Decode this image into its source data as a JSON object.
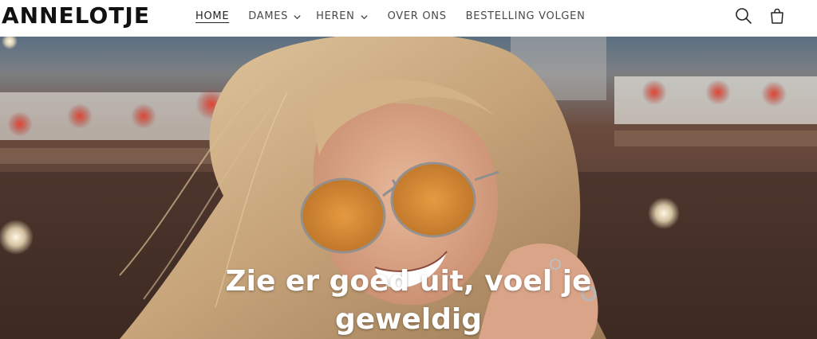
{
  "header": {
    "logo": "ANNELOTJE",
    "nav": [
      {
        "label": "HOME",
        "active": true
      },
      {
        "label": "DAMES",
        "dropdown": true
      },
      {
        "label": "HEREN",
        "dropdown": true
      },
      {
        "label": "OVER ONS"
      },
      {
        "label": "BESTELLING VOLGEN"
      }
    ],
    "icons": {
      "search": "search-icon",
      "cart": "shopping-bag-icon",
      "dropdown": "chevron-down-icon"
    }
  },
  "hero": {
    "heading_line1": "Zie er goed uit, voel je",
    "heading_line2": "geweldig"
  },
  "colors": {
    "header_bg": "#ffffff",
    "text": "#111111",
    "nav_text": "#4a4a4a",
    "hero_text": "#ffffff"
  }
}
